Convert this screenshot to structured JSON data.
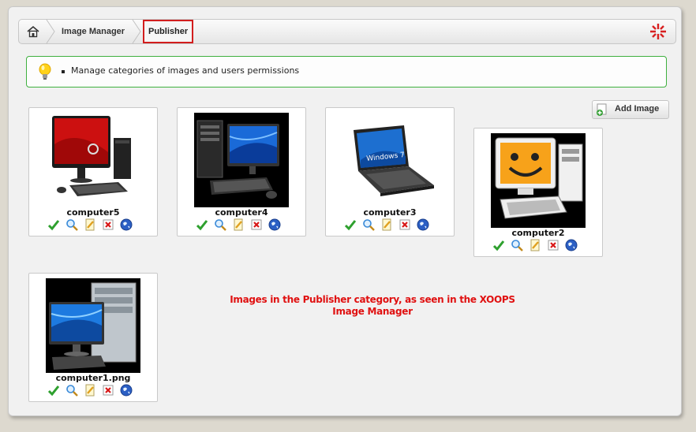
{
  "breadcrumb": {
    "home_icon": "home-icon",
    "items": [
      "Image Manager",
      "Publisher"
    ],
    "right_icon": "close-cross-icon"
  },
  "tip": {
    "icon": "lightbulb-icon",
    "text": "Manage categories of images and users permissions"
  },
  "add_image": {
    "label": "Add Image",
    "icon": "add-image-icon"
  },
  "images": [
    {
      "name": "computer5"
    },
    {
      "name": "computer4"
    },
    {
      "name": "computer3"
    },
    {
      "name": "computer2"
    },
    {
      "name": "computer1.png"
    }
  ],
  "actions": [
    "check-icon",
    "zoom-icon",
    "edit-icon",
    "delete-icon",
    "globe-icon"
  ],
  "caption": "Images in the Publisher category, as seen in the XOOPS Image Manager",
  "colors": {
    "tip_border": "#3fb03f",
    "active_crumb_border": "#d21e1e",
    "caption": "#e01010"
  }
}
